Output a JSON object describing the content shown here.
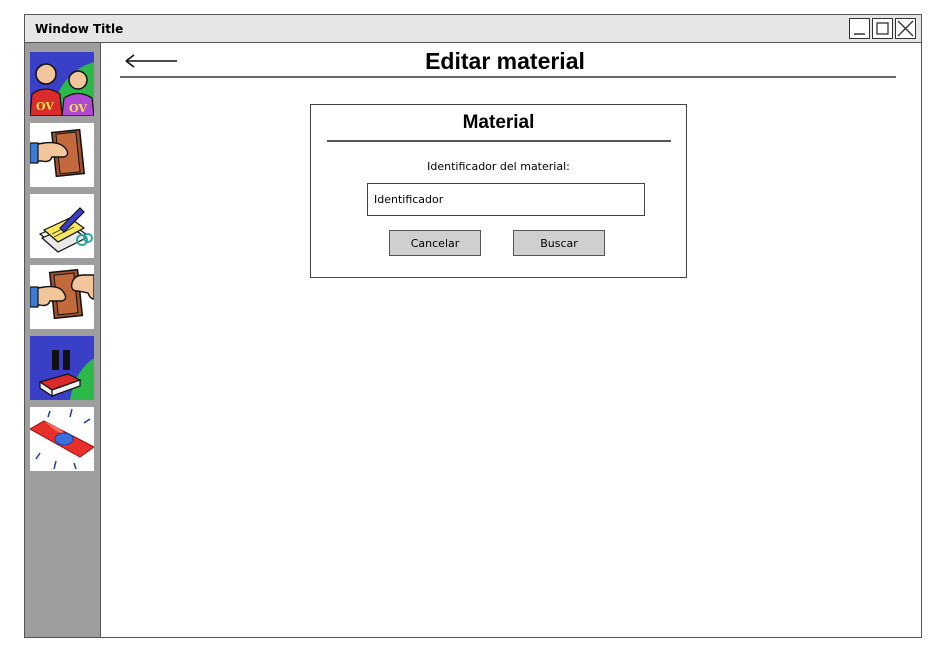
{
  "window": {
    "title": "Window Title",
    "controls": [
      {
        "name": "minimize-icon"
      },
      {
        "name": "maximize-icon"
      },
      {
        "name": "close-icon"
      }
    ]
  },
  "sidebar": {
    "items": [
      {
        "icon": "users-icon",
        "labels": [
          "OV",
          "OV"
        ]
      },
      {
        "icon": "hand-book-icon"
      },
      {
        "icon": "papers-pen-icon"
      },
      {
        "icon": "book-exchange-icon"
      },
      {
        "icon": "book-pause-icon"
      },
      {
        "icon": "alert-light-icon"
      }
    ]
  },
  "header": {
    "back_icon": "arrow-left-icon",
    "title": "Editar material"
  },
  "panel": {
    "title": "Material",
    "field_label": "Identificador del material:",
    "field_placeholder": "Identificador",
    "cancel_label": "Cancelar",
    "search_label": "Buscar"
  }
}
